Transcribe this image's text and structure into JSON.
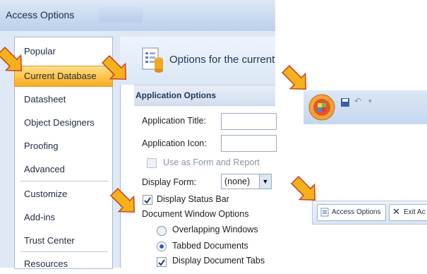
{
  "window": {
    "title": "Access Options"
  },
  "sidebar": {
    "items": [
      {
        "label": "Popular"
      },
      {
        "label": "Current Database"
      },
      {
        "label": "Datasheet"
      },
      {
        "label": "Object Designers"
      },
      {
        "label": "Proofing"
      },
      {
        "label": "Advanced"
      },
      {
        "label": "Customize"
      },
      {
        "label": "Add-ins"
      },
      {
        "label": "Trust Center"
      },
      {
        "label": "Resources"
      }
    ],
    "selected": "Current Database"
  },
  "main": {
    "header_text": "Options for the current",
    "section_title": "Application Options",
    "app_title_label": "Application Title:",
    "app_title_value": "",
    "app_icon_label": "Application Icon:",
    "app_icon_value": "",
    "use_as_form_label": "Use as Form and Report",
    "display_form_label": "Display Form:",
    "display_form_value": "(none)",
    "display_status_bar_label": "Display Status Bar",
    "doc_window_options_label": "Document Window Options",
    "overlapping_windows_label": "Overlapping Windows",
    "tabbed_documents_label": "Tabbed Documents",
    "display_document_tabs_label": "Display Document Tabs"
  },
  "toolbar_crop": {
    "access_options_label": "Access Options",
    "exit_label": "Exit Ac"
  },
  "colors": {
    "selected_nav": "#ffc248",
    "arrow": "#f3b21a",
    "accent_blue": "#1f355a"
  }
}
